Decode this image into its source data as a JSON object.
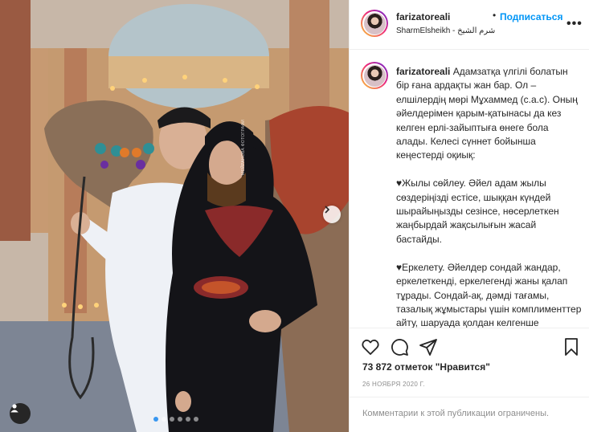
{
  "post": {
    "username": "farizatoreali",
    "bullet": "•",
    "follow_label": "Подписаться",
    "location": "SharmElsheikh - شرم الشيخ",
    "more_icon": "more-horizontal-icon",
    "watermark": "МЕЙРАНОВА ФОТОГРАФИ"
  },
  "caption": {
    "username": "farizatoreali",
    "text": " Адамзатқа үлгілі болатын бір ғана ардақты жан бар. Ол – елшілердің мөрі Мұхаммед (с.а.с). Оның әйелдерімен қарым-қатынасы да кез келген ерлі-зайыптыға өнеге бола алады. Келесі сүннет бойынша кеңестерді оқиық:\n\n♥Жылы сөйлеу. Әйел адам жылы сөздеріңізді естісе, шыққан күндей шырайыңызды сезінсе, нөсерлеткен жаңбырдай жақсылығын жасай бастайды.\n\n♥Еркелету. Әйелдер сондай жандар, еркелеткенді, еркелегенді жаны қалап тұрады. Сондай-ақ, дәмді тағамы, тазалық жұмыстары үшін комплименттер айту, шаруада қолдан келгенше көмектесу –"
  },
  "actions": {
    "like_icon": "heart-icon",
    "comment_icon": "comment-icon",
    "share_icon": "share-icon",
    "save_icon": "bookmark-icon"
  },
  "stats": {
    "likes": "73 872 отметок \"Нравится\"",
    "date": "26 НОЯБРЯ 2020 Г."
  },
  "comments": {
    "disabled_text": "Комментарии к этой публикации ограничены."
  },
  "carousel": {
    "slide_count": 6,
    "active_index": 0
  },
  "colors": {
    "accent": "#0095f6",
    "dot_active": "#3897f0",
    "text": "#262626",
    "muted": "#8e8e8e"
  }
}
